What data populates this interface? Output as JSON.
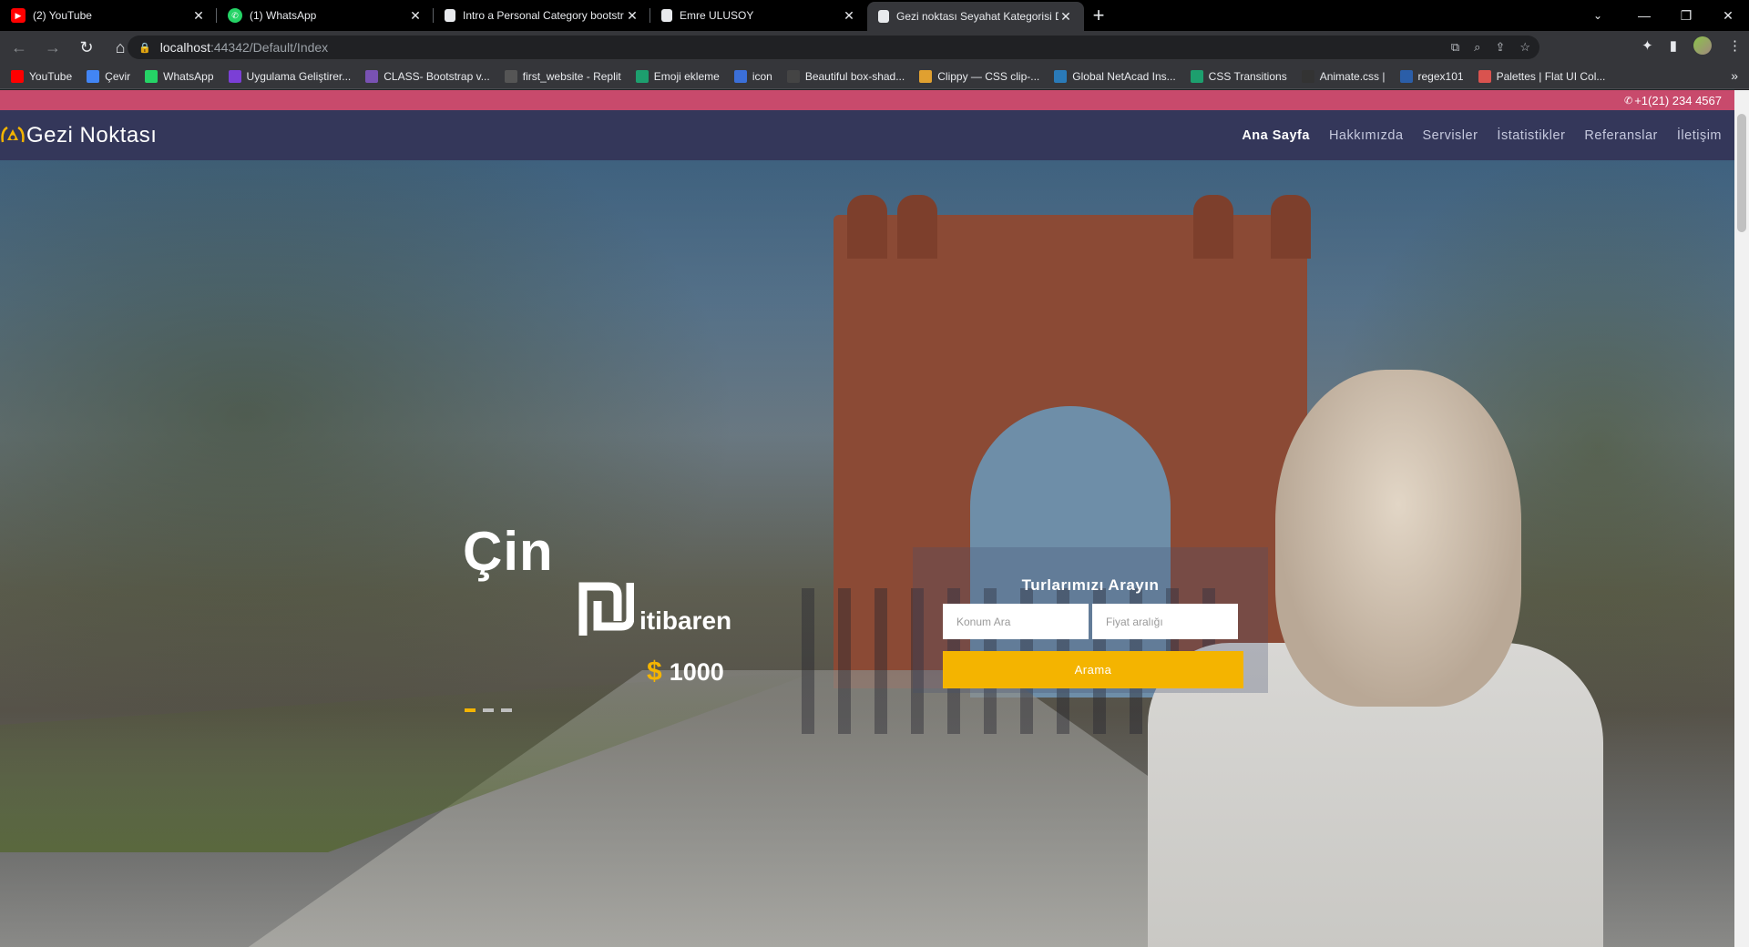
{
  "browser": {
    "tabs": [
      {
        "title": "(2) YouTube",
        "favicon": "youtube-icon",
        "color": "#ff0000"
      },
      {
        "title": "(1) WhatsApp",
        "favicon": "whatsapp-icon",
        "color": "#25d366"
      },
      {
        "title": "Intro a Personal Category bootstr",
        "favicon": "page-icon",
        "color": "#e8eaed"
      },
      {
        "title": "Emre ULUSOY",
        "favicon": "page-icon",
        "color": "#e8eaed"
      },
      {
        "title": "Gezi noktası Seyahat Kategorisi D",
        "favicon": "page-icon",
        "color": "#e8eaed"
      }
    ],
    "url_host": "localhost",
    "url_rest": ":44342/Default/Index",
    "bookmarks": [
      {
        "label": "YouTube",
        "color": "#ff0000"
      },
      {
        "label": "Çevir",
        "color": "#4285f4"
      },
      {
        "label": "WhatsApp",
        "color": "#25d366"
      },
      {
        "label": "Uygulama Geliştirer...",
        "color": "#7b3fd6"
      },
      {
        "label": "CLASS- Bootstrap v...",
        "color": "#7952b3"
      },
      {
        "label": "first_website - Replit",
        "color": "#555555"
      },
      {
        "label": "Emoji ekleme",
        "color": "#1d9f6e"
      },
      {
        "label": "icon",
        "color": "#3b6fd8"
      },
      {
        "label": "Beautiful box-shad...",
        "color": "#444444"
      },
      {
        "label": "Clippy — CSS clip-...",
        "color": "#e0a030"
      },
      {
        "label": "Global NetAcad Ins...",
        "color": "#2a7ab8"
      },
      {
        "label": "CSS Transitions",
        "color": "#1d9f6e"
      },
      {
        "label": "Animate.css |",
        "color": "#333333"
      },
      {
        "label": "regex101",
        "color": "#2b5ea8"
      },
      {
        "label": "Palettes | Flat UI Col...",
        "color": "#d9534f"
      }
    ]
  },
  "site": {
    "phone": "+1(21) 234 4567",
    "brand": "Gezi Noktası",
    "menu": [
      "Ana Sayfa",
      "Hakkımızda",
      "Servisler",
      "İstatistikler",
      "Referanslar",
      "İletişim"
    ],
    "slide": {
      "title": "Çin",
      "from_label": "itibaren",
      "currency": "$",
      "price": "1000",
      "indicator_count": 3,
      "active_indicator": 0
    },
    "search": {
      "title": "Turlarımızı Arayın",
      "location_placeholder": "Konum Ara",
      "price_placeholder": "Fiyat aralığı",
      "button": "Arama"
    }
  },
  "colors": {
    "topbar": "#c84a6c",
    "navbar": "#34375a",
    "accent": "#f4b400"
  }
}
